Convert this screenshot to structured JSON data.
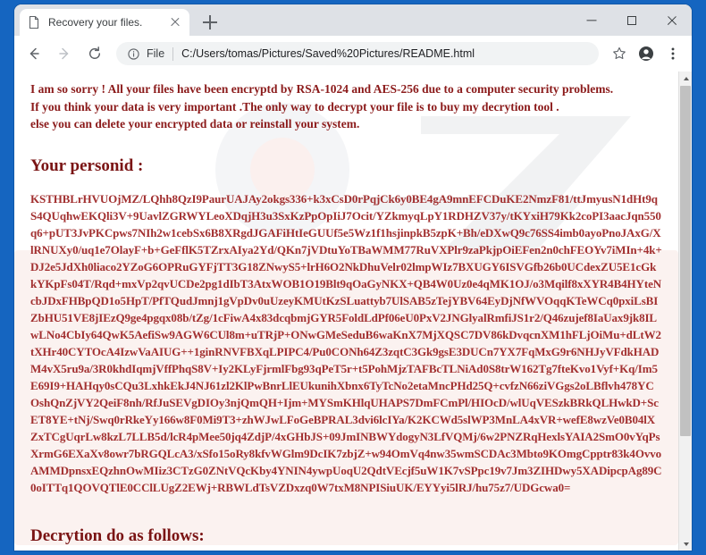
{
  "browser": {
    "tab": {
      "title": "Recovery your files.",
      "favicon_icon": "document-icon",
      "close_icon": "close-icon"
    },
    "new_tab_icon": "plus-icon",
    "window_controls": {
      "minimize_icon": "minimize-icon",
      "maximize_icon": "maximize-icon",
      "close_icon": "close-icon"
    },
    "toolbar": {
      "back_icon": "back-arrow-icon",
      "forward_icon": "forward-arrow-icon",
      "reload_icon": "reload-icon",
      "info_icon": "info-circle-icon",
      "scheme_label": "File",
      "url": "C:/Users/tomas/Pictures/Saved%20Pictures/README.html",
      "bookmark_icon": "star-icon",
      "profile_icon": "account-avatar-icon",
      "menu_icon": "three-dot-menu-icon"
    },
    "scrollbar": {
      "up_icon": "scroll-up-arrow-icon",
      "down_icon": "scroll-down-arrow-icon"
    }
  },
  "page": {
    "intro": {
      "line1": "I am so sorry ! All your files have been encryptd by RSA-1024 and AES-256 due to a computer security problems.",
      "line2": "If you think your data is very important .The only way to decrypt your file is to buy my decrytion tool .",
      "line3": "else you can delete your encrypted data or reinstall your system."
    },
    "personid_heading": "Your personid :",
    "personid_key": "KSTHBLrHVUOjMZ/LQhh8QzI9PaurUAJAy2okgs336+k3xCsD0rPqjCk6y0BE4gA9mnEFCDuKE2NmzF81/ttJmyusN1dHt9qS4QUqhwEKQli3V+9UavlZGRWYLeoXDqjH3u3SxKzPpOpIiJ7Ocit/YZkmyqLpY1RDHZV37y/tKYxiH79Kk2coPI3aacJqn550q6+pUT3JvPKCpws7NIh2w1cebSx6B8XRgdJGAFiHtIeGUUf5e5Wz1f1hsjinpkB5zpK+Bh/eDXwQ9c76SS4imb0ayoPnoJAxG/XlRNUXy0/uq1e7OlayF+b+GeFflK5TZrxAIya2Yd/QKn7jVDtuYoTBaWMM77RuVXPlr9zaPkjpOiEFen2n0chFEOYv7iMIn+4k+DJ2e5JdXh0liaco2YZoG6OPRuGYFjTT3G18ZNwyS5+lrH6O2NkDhuVelr02lmpWIz7BXUGY6ISVGfb26b0UCdexZU5E1cGkkYKpFs04T/Rqd+mxVp2qvUCDe2pg1dIbT3AtxWOB1O19Blt9qOaGyNKX+QB4W0Uz0e4qMK1OJ/o3Mqilf8xXYR4B4HYteNcbJDxFHBpQD1o5HpT/PfTQudJmnj1gVpDv0uUzeyKMUtKzSLuattyb7UlSAB5zTejYBV64EyDjNfWVOqqKTeWCq0pxiLsBIZbHU51VE8jIEzQ9ge4pgqx08b/tZg/1cFiwA4x83dcqbmjGYR5FoldLdPf06eU0PxV2JNGlyalRmfiJS1r2/Q46zujef8IaUax9jk8ILwLNo4CbIy64QwK5AefiSw9AGW6CUl8m+uTRjP+ONwGMeSeduB6waKnX7MjXQSC7DV86kDvqcnXM1hFLjOiMu+dLtW2tXHr40CYTOcA4IzwVaAIUG++1ginRNVFBXqLPIPC4/Pu0CONh64Z3zqtC3Gk9gsE3DUCn7YX7FqMxG9r6NHJyVFdkHADM4vX5ru9a/3R0khdIqmjVffPhqS8V+Iy2KLyFjrmlFbg93qPeT5r+t5PohMjzTAFBcTLNiAd0S8trW162Tg7fteKvo1Vyf+Kq/Im5E69I9+HAHqy0sCQu3LxhkEkJ4NJ61zl2KlPwBnrLlEUkunihXbnx6TyTcNo2etaMncPHd25Q+cvfzN66ziVGgs2oLBflvh478YCOshQnZjVY2QeiF8nh/RfJuSEVgDIOy3njQmQH+Ijm+MYSmKHlqUHAPS7DmFCmPl/HIOcD/wlUqVESzkBRkQLHwkD+ScET8YE+tNj/Swq0rRkeYy166w8F0Mi9T3+zhWJwLFoGeBPRAL3dvi6lcIYa/K2KCWd5slWP3MnLA4xVR+wefE8wzVe0B04lXZxTCgUqrLw8kzL7LLB5d/lcR4pMee50jq4ZdjP/4xGHbJS+09JmINBWYdogyN3LfVQMj/6w2PNZRqHexlsYAIA2SmO0vYqPsXrmG6EXaXv8owr7bRGQLcA3/xSfo15oRy8kfvWGlm9DcIK7zbjZ+w94OmVq4nw35wmSCDAc3Mbto9KOmgCpptr83k4OvvoAMMDpnsxEQzhnOwMIiz3CTzG0ZNtVQcKby4YNIN4ywpUoqU2QdtVEcjf5uW1K7vSPpc19v7Jm3ZIHDwy5XADipcpAg89C0oITTq1QOVQTlE0CClLUgZ2EWj+RBWLdTsVZDxzq0W7txM8NPISiuUK/EYYyi5lRJ/hu75z7/UDGcwa0=",
    "decryption_heading": "Decrytion do as follows:"
  }
}
